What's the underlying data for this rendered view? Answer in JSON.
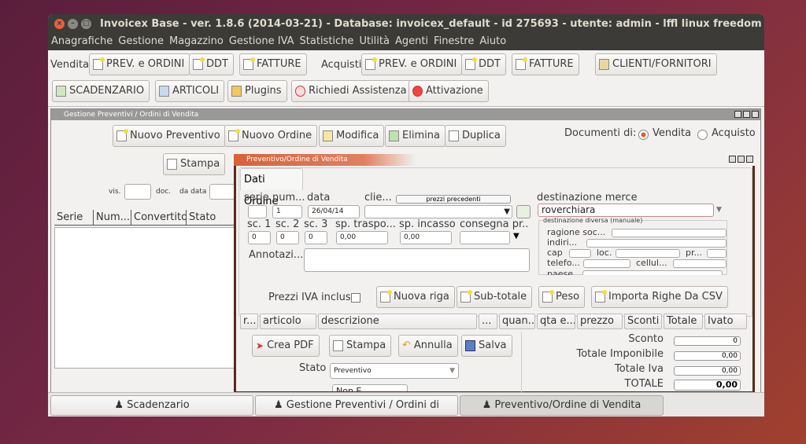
{
  "window": {
    "title": "Invoicex Base - ver. 1.8.6 (2014-03-21) - Database: invoicex_default - id 275693 - utente: admin - lffl linux freedom"
  },
  "menu": [
    "Anagrafiche",
    "Gestione",
    "Magazzino",
    "Gestione IVA",
    "Statistiche",
    "Utilità",
    "Agenti",
    "Finestre",
    "Aiuto"
  ],
  "toolbar": {
    "vendita_label": "Vendita",
    "acquisti_label": "Acquisti",
    "v_prev": "PREV. e ORDINI",
    "v_ddt": "DDT",
    "v_fatture": "FATTURE",
    "a_prev": "PREV. e ORDINI",
    "a_ddt": "DDT",
    "a_fatture": "FATTURE",
    "clienti": "CLIENTI/FORNITORI",
    "scadenzario": "SCADENZARIO",
    "articoli": "ARTICOLI",
    "plugins": "Plugins",
    "assistenza": "Richiedi Assistenza",
    "attivazione": "Attivazione"
  },
  "gestione": {
    "title": "Gestione Preventivi / Ordini di Vendita",
    "nuovo_preventivo": "Nuovo Preventivo",
    "nuovo_ordine": "Nuovo Ordine",
    "modifica": "Modifica",
    "elimina": "Elimina",
    "duplica": "Duplica",
    "stampa": "Stampa",
    "documenti_di": "Documenti di:",
    "vendita": "Vendita",
    "acquisto": "Acquisto",
    "vis": "vis.",
    "doc": "doc.",
    "da_data": "da data",
    "columns": [
      "Serie",
      "Num...",
      "Convertito",
      "Stato"
    ]
  },
  "preventivo": {
    "title": "Preventivo/Ordine di Vendita",
    "tab": "Dati Ordine",
    "serie": "serie",
    "num": "num...",
    "num_value": "1",
    "data": "data",
    "data_value": "26/04/14",
    "clie": "clie...",
    "prezzi_precedenti": "prezzi precedenti",
    "destinazione_merce": "destinazione merce",
    "destinazione_value": "roverchiara",
    "dest_diversa": "destinazione diversa (manuale)",
    "ragione_soc": "ragione soc...",
    "indiri": "indiri...",
    "cap": "cap",
    "loc": "loc.",
    "pr": "pr...",
    "telefo": "telefo...",
    "cellul": "cellul...",
    "paese": "paese",
    "sc1": "sc. 1",
    "sc2": "sc. 2",
    "sc3": "sc. 3",
    "sc1_value": "0",
    "sc2_value": "0",
    "sc3_value": "0",
    "sp_trasporto": "sp. traspo...",
    "sp_trasporto_value": "0,00",
    "sp_incasso": "sp. incasso",
    "sp_incasso_value": "0,00",
    "consegna": "consegna pr...",
    "annotazioni": "Annotazi...",
    "prezzi_iva": "Prezzi IVA inclusa",
    "nuova_riga": "Nuova riga",
    "sub_totale": "Sub-totale",
    "peso": "Peso",
    "importa_csv": "Importa Righe Da CSV",
    "columns": [
      "r...",
      "articolo",
      "descrizione",
      "...",
      "quan...",
      "qta e...",
      "prezzo",
      "Sconti",
      "Totale",
      "Ivato"
    ],
    "crea_pdf": "Crea PDF",
    "stampa": "Stampa",
    "annulla": "Annulla",
    "salva": "Salva",
    "stato": "Stato",
    "stato_value": "Preventivo",
    "partial_field": "Non E...",
    "sconto": "Sconto",
    "sconto_value": "0",
    "tot_imponibile": "Totale Imponibile",
    "tot_imponibile_value": "0,00",
    "tot_iva": "Totale Iva",
    "tot_iva_value": "0,00",
    "totale": "TOTALE",
    "totale_value": "0,00"
  },
  "taskbar": [
    "Scadenzario",
    "Gestione Preventivi / Ordini di Vendita",
    "Preventivo/Ordine di Vendita"
  ]
}
